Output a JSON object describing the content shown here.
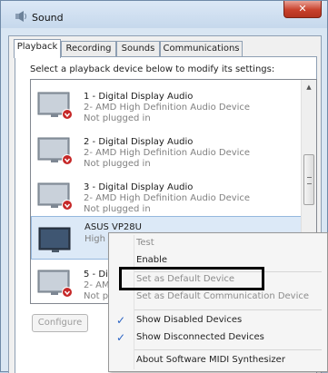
{
  "window": {
    "title": "Sound",
    "close_glyph": "✕"
  },
  "tabs": [
    {
      "label": "Playback",
      "active": true
    },
    {
      "label": "Recording"
    },
    {
      "label": "Sounds"
    },
    {
      "label": "Communications"
    }
  ],
  "instruction": "Select a playback device below to modify its settings:",
  "devices": [
    {
      "name": "1 - Digital Display Audio",
      "sub": "2- AMD High Definition Audio Device",
      "status": "Not plugged in"
    },
    {
      "name": "2 - Digital Display Audio",
      "sub": "2- AMD High Definition Audio Device",
      "status": "Not plugged in"
    },
    {
      "name": "3 - Digital Display Audio",
      "sub": "2- AMD High Definition Audio Device",
      "status": "Not plugged in"
    },
    {
      "name": "ASUS VP28U",
      "sub": "High D"
    },
    {
      "name": "5 - Dig",
      "sub": "2- AM",
      "status": "Not pl"
    }
  ],
  "configure_label": "Configure",
  "context_menu": {
    "items": [
      {
        "label": "Test"
      },
      {
        "label": "Enable"
      },
      {
        "label": "Set as Default Device"
      },
      {
        "label": "Set as Default Communication Device"
      },
      {
        "label": "Show Disabled Devices",
        "checked": true
      },
      {
        "label": "Show Disconnected Devices",
        "checked": true
      },
      {
        "label": "About Software MIDI Synthesizer"
      }
    ],
    "check_glyph": "✓"
  },
  "icons": {
    "app": "speaker-icon",
    "device": "monitor-icon",
    "status": "red-down-arrow-badge"
  },
  "colors": {
    "selection": "#dce9f7",
    "badge_red": "#c62828",
    "check_blue": "#2a63c4"
  }
}
